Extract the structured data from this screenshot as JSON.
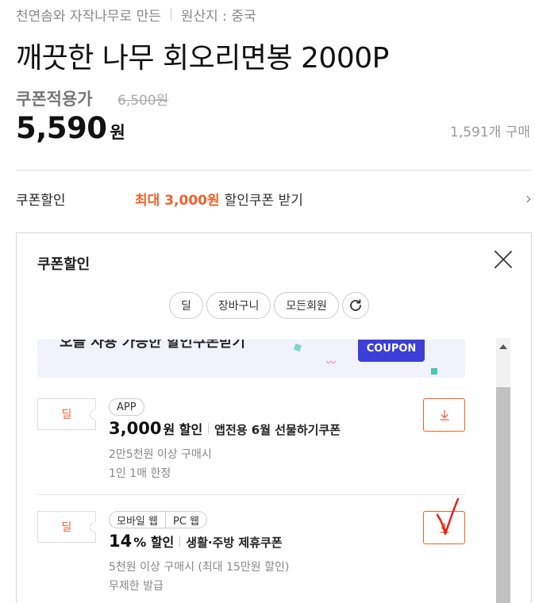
{
  "product": {
    "meta_left": "천연솜와 자작나무로 만든",
    "meta_right": "원산지 : 중국",
    "title": "깨끗한 나무 회오리면봉 2000P",
    "coupon_price_label": "쿠폰적용가",
    "original_price": "6,500원",
    "price_number": "5,590",
    "price_unit": "원",
    "sold_count": "1,591개 구매"
  },
  "coupon_row": {
    "label": "쿠폰할인",
    "max_text": "최대 3,000원",
    "rest_text": "할인쿠폰 받기",
    "chevron": "›"
  },
  "panel": {
    "title": "쿠폰할인",
    "filter_chips": [
      "딜",
      "장바구니",
      "모든회원"
    ],
    "refresh_icon": "refresh-icon",
    "banner": {
      "text": "오늘 사용 가능한 할인쿠폰받기",
      "tag": "COUPON"
    },
    "coupons": [
      {
        "ticket": "딜",
        "tags": [
          "APP"
        ],
        "amount": "3,000",
        "suffix": "원 할인",
        "name": "앱전용 6월 선물하기쿠폰",
        "condition1": "2만5천원 이상 구매시",
        "condition2": "1인 1매 한정"
      },
      {
        "ticket": "딜",
        "tags": [
          "모바일 웹",
          "PC 웹"
        ],
        "amount": "14",
        "suffix": "% 할인",
        "name": "생활·주방 제휴쿠폰",
        "condition1": "5천원 이상 구매시 (최대 15만원 할인)",
        "condition2": "무제한 발급"
      }
    ]
  },
  "colors": {
    "accent": "#f0612a",
    "coupon_blue": "#3b3fd8",
    "annotation_red": "#e8201c"
  }
}
